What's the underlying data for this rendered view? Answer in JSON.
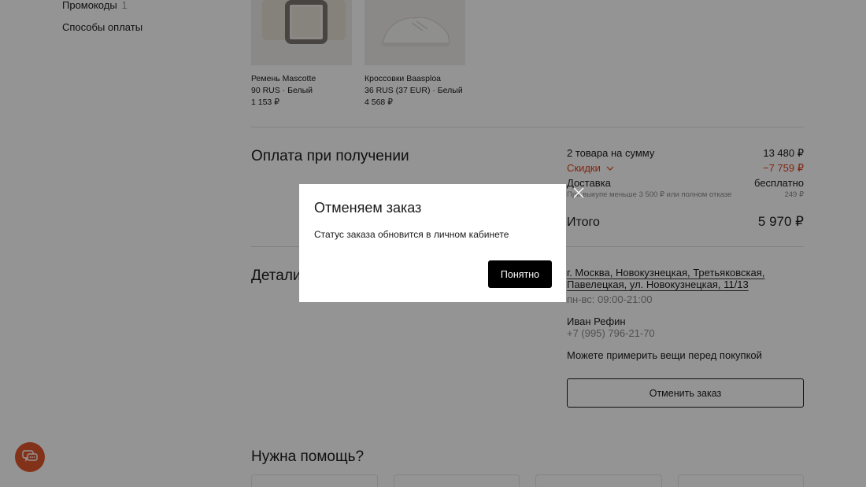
{
  "sidebar": {
    "items": [
      {
        "label": "Промокоды",
        "count": "1"
      },
      {
        "label": "Способы оплаты",
        "count": ""
      }
    ]
  },
  "products": [
    {
      "name": "Ремень Mascotte",
      "meta": "90 RUS · Белый",
      "price": "1 153 ₽",
      "image_icon": "belt-image"
    },
    {
      "name": "Кроссовки Baasploa",
      "meta": "36 RUS (37 EUR) · Белый",
      "price": "4 568 ₽",
      "image_icon": "sneakers-image"
    }
  ],
  "payment": {
    "title": "Оплата при получении"
  },
  "summary": {
    "items_label": "2 товара на сумму",
    "items_value": "13 480 ₽",
    "discount_label": "Скидки",
    "discount_value": "−7 759 ₽",
    "delivery_label": "Доставка",
    "delivery_value": "бесплатно",
    "delivery_note": "При выкупе меньше 3 500 ₽ или полном отказе",
    "delivery_note_value": "249 ₽",
    "total_label": "Итого",
    "total_value": "5 970 ₽"
  },
  "details": {
    "title": "Детали",
    "address_line1": "г. Москва, Новокузнецкая, Третьяковская,",
    "address_line2": "Павелецкая, ул. Новокузнецкая, 11/13",
    "hours": "пн-вс: 09:00-21:00",
    "recipient_name": "Иван Рефин",
    "recipient_phone": "+7 (995) 796-21-70",
    "try_on_note": "Можете примерить вещи перед покупкой",
    "cancel_button": "Отменить заказ"
  },
  "help": {
    "title": "Нужна помощь?"
  },
  "modal": {
    "title": "Отменяем заказ",
    "text": "Статус заказа обновится в личном кабинете",
    "ok_button": "Понятно"
  },
  "colors": {
    "accent_red": "#e0401c",
    "chat_button": "#e2572d",
    "overlay": "rgba(0,0,0,0.42)"
  }
}
